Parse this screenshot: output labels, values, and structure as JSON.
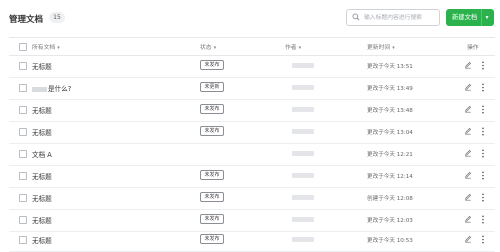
{
  "header": {
    "title": "管理文档",
    "count": "15",
    "search_placeholder": "输入标题内容进行搜索",
    "new_button": "新建文档"
  },
  "table": {
    "columns": {
      "all_docs": "所有文档",
      "status": "状态",
      "author": "作者",
      "updated": "更新时间",
      "actions": "操作"
    },
    "rows": [
      {
        "name": "无标题",
        "status": "未发布",
        "time": "更改于今天 13:51"
      },
      {
        "name": "是什么?",
        "status": "未更新",
        "time": "更改于今天 13:49",
        "name_blurred": true
      },
      {
        "name": "无标题",
        "status": "未发布",
        "time": "更改于今天 13:48"
      },
      {
        "name": "无标题",
        "status": "未发布",
        "time": "更改于今天 13:04"
      },
      {
        "name": "文档 A",
        "status": "",
        "time": "更改于今天 12:21"
      },
      {
        "name": "无标题",
        "status": "未发布",
        "time": "更改于今天 12:14"
      },
      {
        "name": "无标题",
        "status": "未发布",
        "time": "创建于今天 12:08"
      },
      {
        "name": "无标题",
        "status": "未发布",
        "time": "更改于今天 12:03"
      },
      {
        "name": "无标题",
        "status": "未发布",
        "time": "更改于今天 10:53"
      }
    ]
  },
  "colors": {
    "accent": "#2bb24c"
  },
  "icons": {
    "search": "search-icon",
    "edit": "pencil-icon",
    "more": "more-vertical-icon"
  }
}
